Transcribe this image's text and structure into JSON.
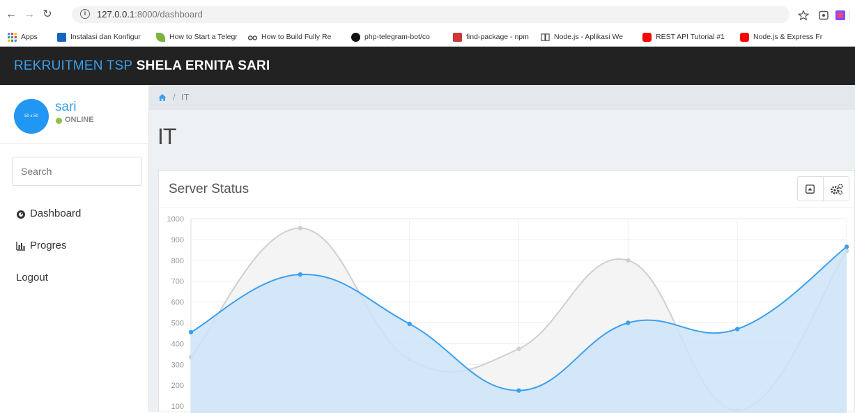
{
  "browser": {
    "url_host": "127.0.0.1",
    "url_rest": ":8000/dashboard",
    "bookmarks": [
      {
        "label": "Apps",
        "icon": "apps-grid-icon",
        "color": "#4285f4"
      },
      {
        "label": "Instalasi dan Konfigur",
        "icon": "site-favicon",
        "color": "#1565c0"
      },
      {
        "label": "How to Start a Telegr",
        "icon": "leaf-icon",
        "color": "#7cb342"
      },
      {
        "label": "How to Build Fully Re",
        "icon": "glasses-icon",
        "color": "#333333"
      },
      {
        "label": "php-telegram-bot/co",
        "icon": "github-icon",
        "color": "#111111"
      },
      {
        "label": "find-package - npm",
        "icon": "npm-icon",
        "color": "#cb3837"
      },
      {
        "label": "Node.js - Aplikasi We",
        "icon": "book-icon",
        "color": "#444444"
      },
      {
        "label": "REST API Tutorial #1",
        "icon": "youtube-icon",
        "color": "#ff0000"
      },
      {
        "label": "Node.js & Express Fr",
        "icon": "youtube-icon",
        "color": "#ff0000"
      }
    ]
  },
  "header": {
    "brand_accent": "REKRUITMEN TSP",
    "brand_name": "SHELA ERNITA SARI"
  },
  "sidebar": {
    "avatar_text": "50 x 50",
    "user_name": "sari",
    "status": "ONLINE",
    "search_placeholder": "Search",
    "menu": [
      {
        "label": "Dashboard",
        "icon": "dashboard-icon"
      },
      {
        "label": "Progres",
        "icon": "bar-chart-icon"
      },
      {
        "label": "Logout",
        "icon": ""
      }
    ]
  },
  "main": {
    "breadcrumb_separator": "/",
    "breadcrumb_current": "IT",
    "page_title": "IT",
    "panel_title": "Server Status"
  },
  "colors": {
    "accent": "#3ba0ee",
    "header_bg": "#222222",
    "online": "#8bc34a",
    "series_blue": "#3ba0ee",
    "series_gray": "#d0d0d0"
  },
  "chart_data": {
    "type": "area",
    "ylim": [
      0,
      1000
    ],
    "yticks": [
      100,
      200,
      300,
      400,
      500,
      600,
      700,
      800,
      900,
      1000
    ],
    "x": [
      1,
      2,
      3,
      4,
      5,
      6,
      7
    ],
    "series": [
      {
        "values": [
          335,
          955,
          325,
          375,
          800,
          80,
          845
        ],
        "color": "#cfcfcf",
        "fill": "#f4f4f4"
      },
      {
        "values": [
          455,
          732,
          495,
          175,
          500,
          470,
          865
        ],
        "color": "#3ba0ee",
        "fill": "#cde4f9"
      }
    ]
  }
}
